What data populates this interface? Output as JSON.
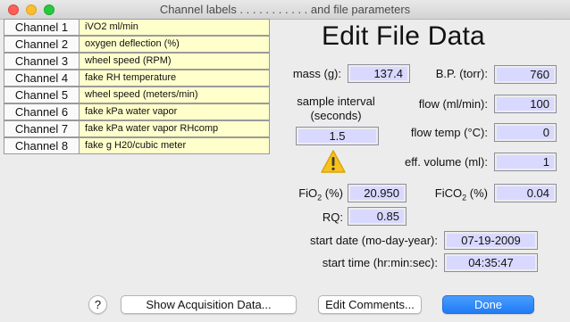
{
  "window": {
    "title": "Channel labels . . . . . . . . . . . and file parameters"
  },
  "channels": [
    {
      "name": "Channel 1",
      "label": "iVO2 ml/min"
    },
    {
      "name": "Channel 2",
      "label": "oxygen deflection (%)"
    },
    {
      "name": "Channel 3",
      "label": "wheel speed (RPM)"
    },
    {
      "name": "Channel 4",
      "label": "fake RH temperature"
    },
    {
      "name": "Channel 5",
      "label": "wheel speed (meters/min)"
    },
    {
      "name": "Channel 6",
      "label": "fake kPa water vapor"
    },
    {
      "name": "Channel 7",
      "label": "fake kPa water vapor RHcomp"
    },
    {
      "name": "Channel 8",
      "label": "fake g H20/cubic meter"
    }
  ],
  "form": {
    "heading": "Edit File Data",
    "mass": {
      "label": "mass (g):",
      "value": "137.4"
    },
    "bp": {
      "label": "B.P. (torr):",
      "value": "760"
    },
    "sample_interval": {
      "label_line1": "sample interval",
      "label_line2": "(seconds)",
      "value": "1.5"
    },
    "flow": {
      "label": "flow (ml/min):",
      "value": "100"
    },
    "flow_temp": {
      "label": "flow temp (°C):",
      "value": "0"
    },
    "eff_volume": {
      "label": "eff. volume (ml):",
      "value": "1"
    },
    "fio2": {
      "label_pre": "FiO",
      "label_sub": "2",
      "label_post": " (%)",
      "value": "20.950"
    },
    "fico2": {
      "label_pre": "FiCO",
      "label_sub": "2",
      "label_post": " (%)",
      "value": "0.04"
    },
    "rq": {
      "label": "RQ:",
      "value": "0.85"
    },
    "start_date": {
      "label": "start date (mo-day-year):",
      "value": "07-19-2009"
    },
    "start_time": {
      "label": "start time (hr:min:sec):",
      "value": "04:35:47"
    },
    "warning_icon": "warning-triangle-icon"
  },
  "buttons": {
    "help": "?",
    "show_acquisition": "Show Acquisition Data...",
    "edit_comments": "Edit Comments...",
    "done": "Done"
  },
  "colors": {
    "field_bg": "#d9d9ff",
    "label_bg": "#ffffcc",
    "primary": "#1f7bf6",
    "warning": "#f7c21c"
  }
}
